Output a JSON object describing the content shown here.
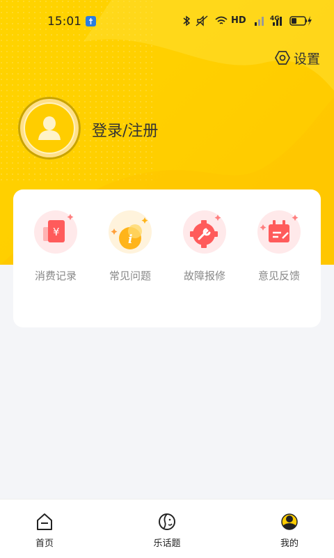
{
  "status_bar": {
    "time": "15:01",
    "network": "HD",
    "signal_type": "4G"
  },
  "header": {
    "settings_label": "设置",
    "login_label": "登录/注册"
  },
  "features": [
    {
      "label": "消费记录",
      "icon": "receipt-yen-icon"
    },
    {
      "label": "常见问题",
      "icon": "info-icon"
    },
    {
      "label": "故障报修",
      "icon": "wrench-gear-icon"
    },
    {
      "label": "意见反馈",
      "icon": "feedback-icon"
    }
  ],
  "tabbar": {
    "items": [
      {
        "label": "首页",
        "icon": "home-icon"
      },
      {
        "label": "乐话题",
        "icon": "topic-face-icon"
      },
      {
        "label": "我的",
        "icon": "profile-icon"
      }
    ]
  },
  "colors": {
    "brand_yellow": "#ffd000",
    "card_bg": "#ffffff",
    "page_bg": "#f4f5f8",
    "feature_red": "#ff5b5b",
    "feature_orange": "#ffb41a"
  }
}
